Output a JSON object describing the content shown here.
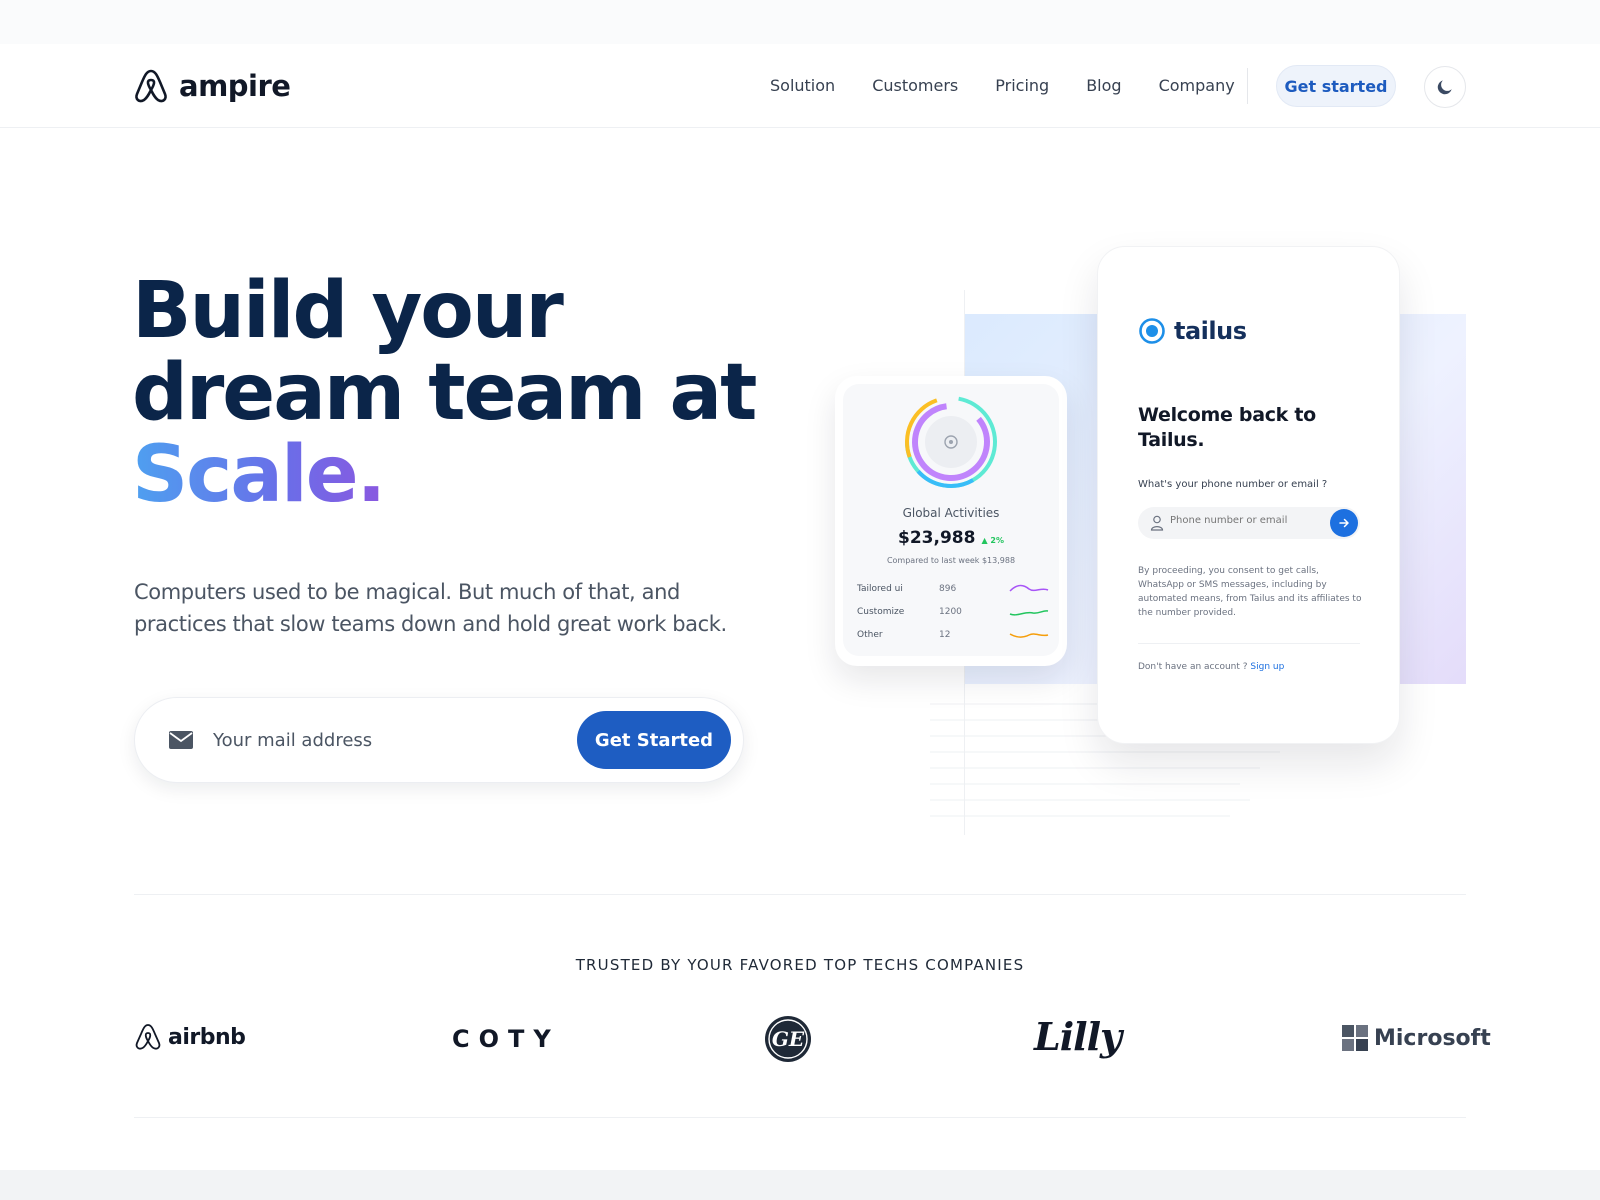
{
  "header": {
    "brand": "ampire",
    "nav": [
      "Solution",
      "Customers",
      "Pricing",
      "Blog",
      "Company"
    ],
    "cta_label": "Get started",
    "theme_icon": "moon-icon"
  },
  "hero": {
    "title_line1": "Build your",
    "title_line2": "dream team at",
    "title_highlight": "Scale.",
    "description": "Computers used to be magical. But much of that, and practices that slow teams down and hold great work back.",
    "email_placeholder": "Your mail address",
    "cta_label": "Get Started"
  },
  "stats_card": {
    "label": "Global Activities",
    "value": "$23,988",
    "trend": "▲ 2%",
    "subtitle": "Compared to last week $13,988",
    "rows": [
      {
        "label": "Tailored ui",
        "value": "896",
        "color": "#a855f7"
      },
      {
        "label": "Customize",
        "value": "1200",
        "color": "#22c55e"
      },
      {
        "label": "Other",
        "value": "12",
        "color": "#f59e0b"
      }
    ]
  },
  "login_card": {
    "brand": "tailus",
    "title": "Welcome back to Tailus.",
    "question": "What's your phone number or email ?",
    "input_placeholder": "Phone number or email",
    "consent": "By proceeding, you consent to get calls, WhatsApp or SMS messages, including by automated means, from Tailus and its affiliates to the number provided.",
    "signup_prompt": "Don't have an account ?",
    "signup_link": "Sign up"
  },
  "trusted": {
    "title": "TRUSTED BY YOUR FAVORED TOP TECHS COMPANIES",
    "brands": [
      "airbnb",
      "COTY",
      "GE",
      "Lilly",
      "Microsoft"
    ]
  },
  "colors": {
    "primary": "#1e5dc2",
    "heading": "#0b2549",
    "gradient_start": "#4ea0f0",
    "gradient_end": "#8a58e0"
  }
}
